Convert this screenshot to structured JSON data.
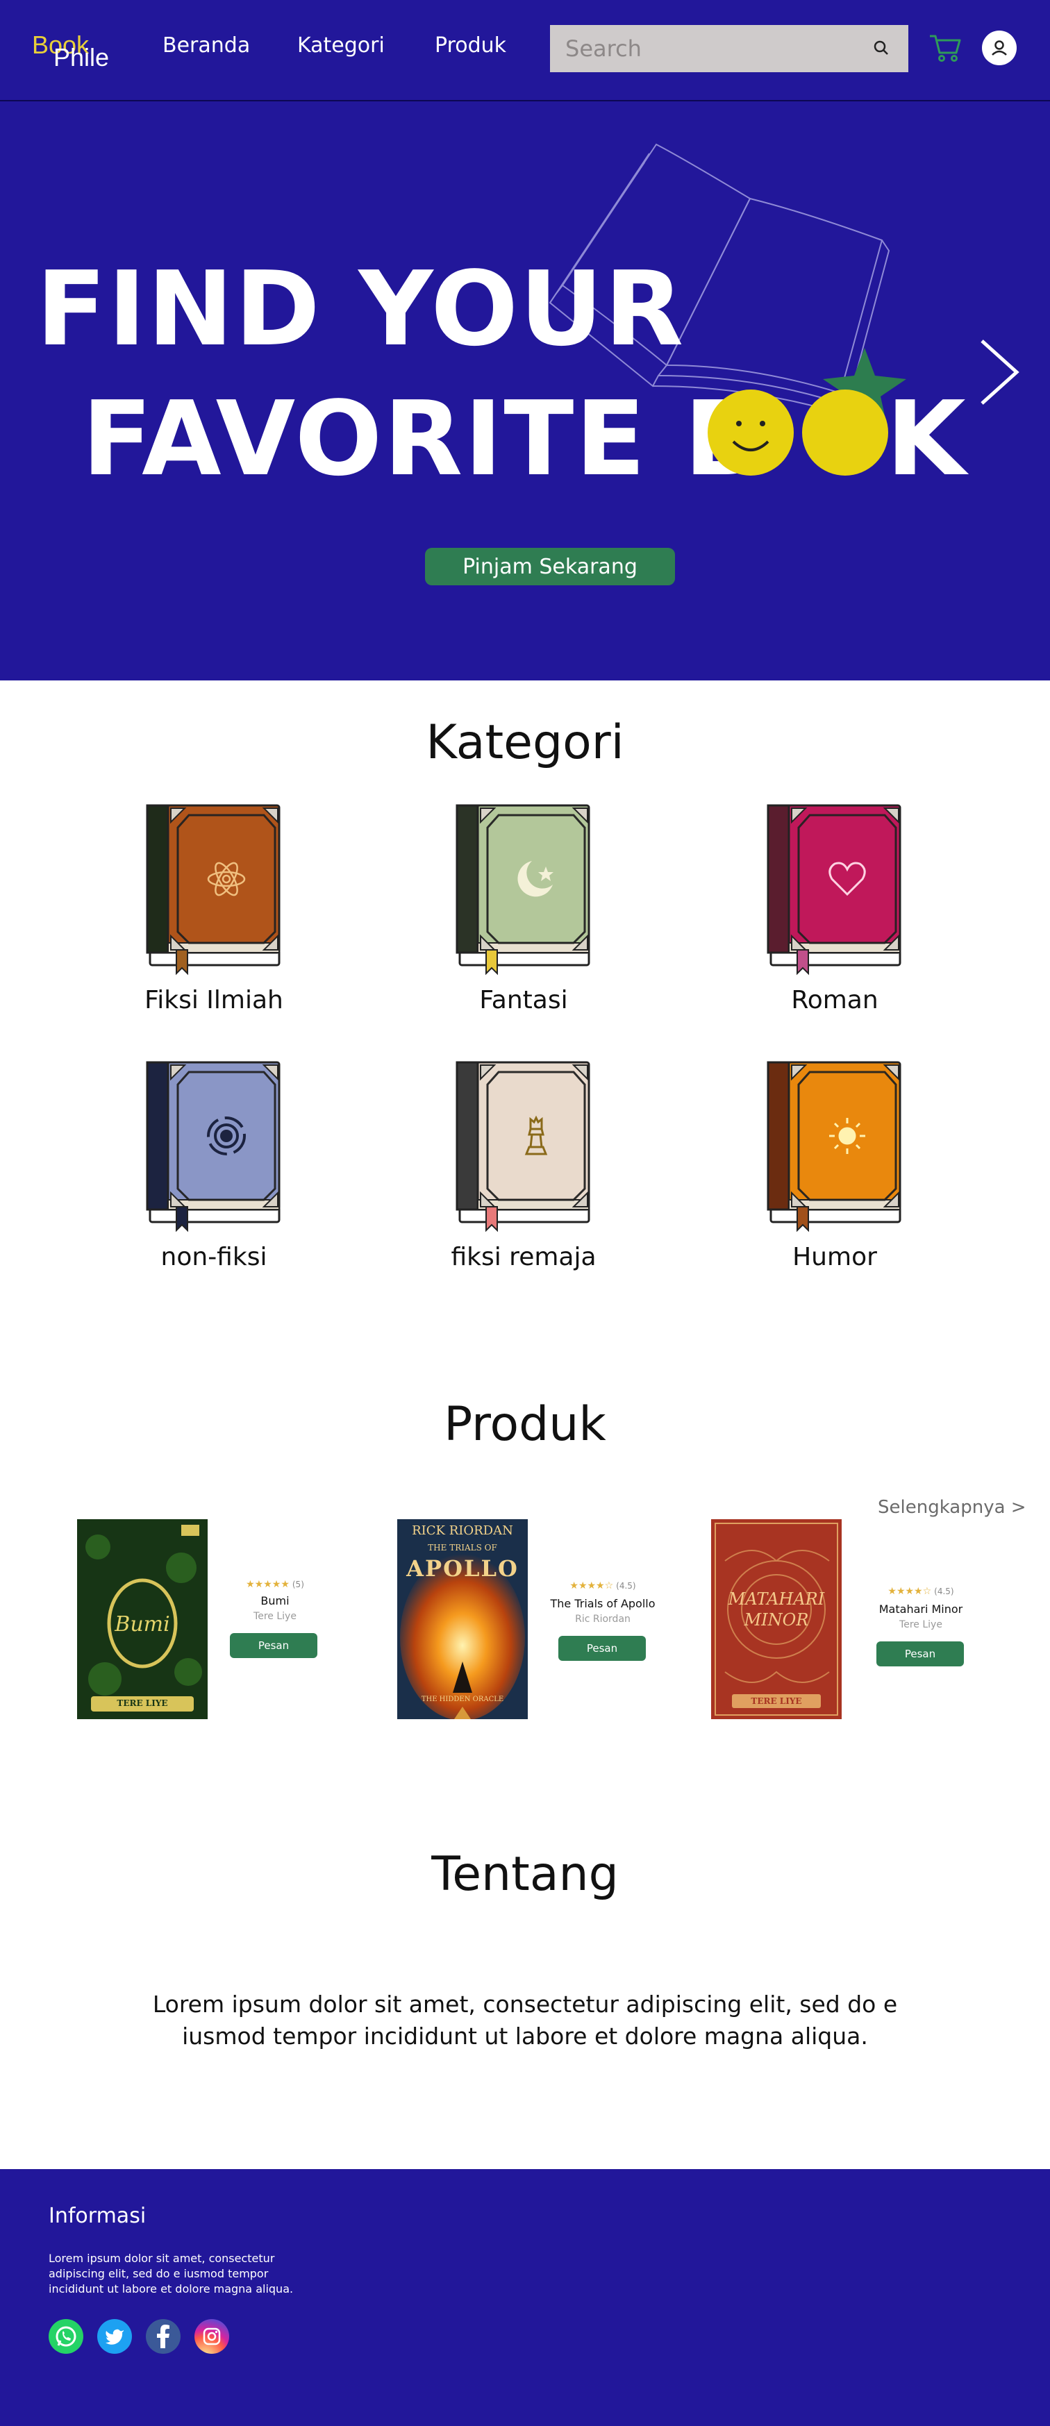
{
  "nav": {
    "logo_top": "Book",
    "logo_bottom": "Phile",
    "links": [
      "Beranda",
      "Kategori",
      "Produk"
    ],
    "search_placeholder": "Search",
    "icons": [
      "search-icon",
      "cart-icon",
      "user-icon"
    ]
  },
  "hero": {
    "line1": "FIND YOUR",
    "line2_start": "FAVORITE B",
    "line2_end": "K",
    "cta": "Pinjam Sekarang",
    "next_icon": "chevron-right-icon"
  },
  "kategori": {
    "title": "Kategori",
    "items": [
      {
        "label": "Fiksi Ilmiah",
        "icon": "atom-icon",
        "color": "#b0541a",
        "spine": "#1f2b1a",
        "ribbon": "#a06020"
      },
      {
        "label": "Fantasi",
        "icon": "moon-star-icon",
        "color": "#b3c79a",
        "spine": "#2b3326",
        "ribbon": "#e8c83a"
      },
      {
        "label": "Roman",
        "icon": "heart-icon",
        "color": "#c0185a",
        "spine": "#5a1d2e",
        "ribbon": "#c0508a"
      },
      {
        "label": "non-fiksi",
        "icon": "target-icon",
        "color": "#8a96c6",
        "spine": "#1c2340",
        "ribbon": "#1c2340"
      },
      {
        "label": "fiksi remaja",
        "icon": "chess-icon",
        "color": "#e9dacc",
        "spine": "#3a3a3a",
        "ribbon": "#e87a7a"
      },
      {
        "label": "Humor",
        "icon": "sun-icon",
        "color": "#e9880d",
        "spine": "#6b2c10",
        "ribbon": "#a0501a"
      }
    ]
  },
  "produk": {
    "title": "Produk",
    "more": "Selengkapnya >",
    "items": [
      {
        "title": "Bumi",
        "author": "Tere Liye",
        "stars": "★★★★★",
        "count": "(5)",
        "button": "Pesan",
        "cover_title": "Bumi",
        "cover_author": "TERE LIYE"
      },
      {
        "title": "The Trials of Apollo",
        "author": "Ric Riordan",
        "stars": "★★★★☆",
        "count": "(4.5)",
        "button": "Pesan",
        "cover_top": "RICK RIORDAN",
        "cover_title": "APOLLO",
        "cover_sub": "THE TRIALS OF",
        "cover_bottom": "THE HIDDEN ORACLE"
      },
      {
        "title": "Matahari Minor",
        "author": "Tere Liye",
        "stars": "★★★★☆",
        "count": "(4.5)",
        "button": "Pesan",
        "cover_title": "MATAHARI MINOR",
        "cover_author": "TERE LIYE"
      }
    ]
  },
  "tentang": {
    "title": "Tentang",
    "text_line1": "Lorem ipsum dolor sit amet, consectetur adipiscing elit, sed do e",
    "text_line2": "iusmod tempor incididunt ut labore et dolore magna aliqua."
  },
  "footer": {
    "heading": "Informasi",
    "line1": "Lorem ipsum dolor sit amet, consectetur",
    "line2": "adipiscing elit, sed do e iusmod tempor",
    "line3": "incididunt ut labore et dolore magna aliqua.",
    "socials": [
      "whatsapp-icon",
      "twitter-icon",
      "facebook-icon",
      "instagram-icon"
    ]
  }
}
